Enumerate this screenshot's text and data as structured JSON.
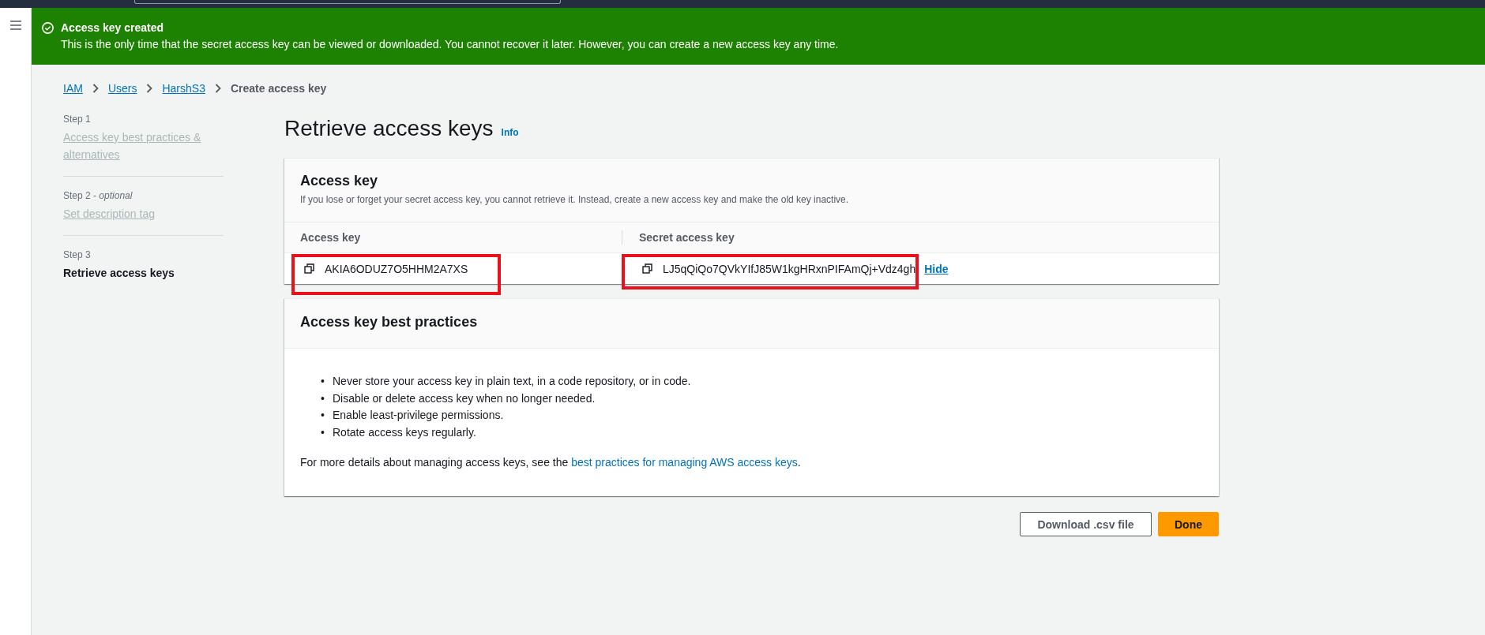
{
  "flash": {
    "title": "Access key created",
    "message": "This is the only time that the secret access key can be viewed or downloaded. You cannot recover it later. However, you can create a new access key any time."
  },
  "breadcrumbs": [
    {
      "label": "IAM",
      "kind": "link"
    },
    {
      "label": "Users",
      "kind": "link"
    },
    {
      "label": "HarshS3",
      "kind": "link"
    },
    {
      "label": "Create access key",
      "kind": "current"
    }
  ],
  "steps": [
    {
      "step": "Step 1",
      "title": "Access key best practices & alternatives",
      "selected": false
    },
    {
      "step": "Step 2 - *optional*",
      "title": "Set description tag",
      "selected": false
    },
    {
      "step": "Step 3",
      "title": "Retrieve access keys",
      "selected": true
    }
  ],
  "page": {
    "title": "Retrieve access keys",
    "info_link": "Info"
  },
  "access_key_panel": {
    "title": "Access key",
    "description": "If you lose or forget your secret access key, you cannot retrieve it. Instead, create a new access key and make the old key inactive.",
    "columns": [
      "Access key",
      "Secret access key"
    ],
    "values": [
      {
        "value": "AKIA6ODUZ7O5HHM2A7XS",
        "highlighted": true
      },
      {
        "value": "LJ5qQiQo7QVkYIfJ85W1kgHRxnPIFAmQj+Vdz4gh",
        "highlighted": true,
        "toggle": "Hide"
      }
    ]
  },
  "best_practices": {
    "title": "Access key best practices",
    "items": [
      {
        "marker": "•",
        "text": "Never store your access key in plain text, in a code repository, or in code."
      },
      {
        "marker": "•",
        "text": "Disable or delete access key when no longer needed."
      },
      {
        "marker": "•",
        "text": "Enable least-privilege permissions."
      },
      {
        "marker": "•",
        "text": "Rotate access keys regularly."
      }
    ],
    "note_before": "For more details about managing access keys, see the ",
    "note_link": "best practices for managing AWS access keys",
    "note_after": "."
  },
  "actions": [
    {
      "label": "Download .csv file",
      "kind": "secondary"
    },
    {
      "label": "Done",
      "kind": "primary"
    }
  ]
}
